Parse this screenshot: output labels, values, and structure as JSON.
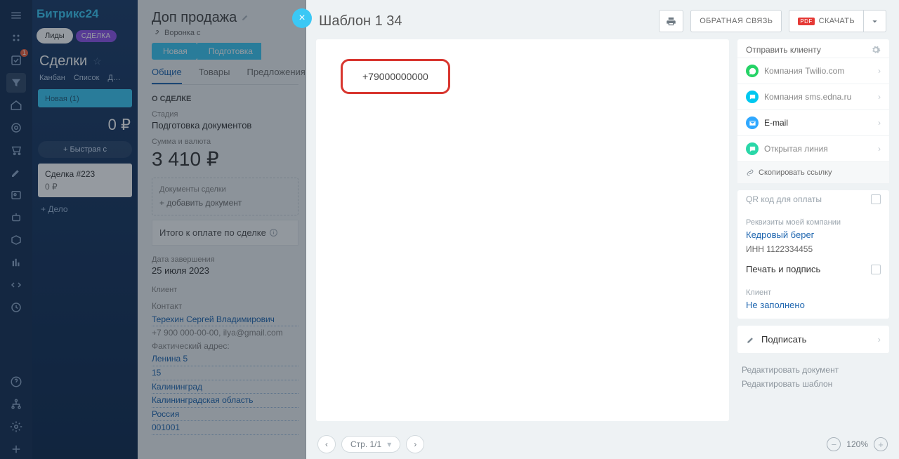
{
  "logo": {
    "a": "Битрикс",
    "b": "24"
  },
  "pills": {
    "leads": "Лиды",
    "dealBadge": "СДЕЛКА"
  },
  "side": {
    "title": "Сделки",
    "views": {
      "kanban": "Канбан",
      "list": "Список",
      "more": "Д…"
    },
    "stage": "Новая",
    "stageCount": "(1)",
    "sum": "0 ₽",
    "quick": "+  Быстрая с",
    "card": {
      "title": "Сделка #223",
      "price": "0 ₽"
    },
    "addTask": "+ Дело"
  },
  "deal": {
    "title": "Доп продажа",
    "crumb": "Воронка с",
    "stages": [
      "Новая",
      "Подготовка"
    ],
    "tabs": {
      "general": "Общие",
      "products": "Товары",
      "offers": "Предложения"
    },
    "aboutHead": "О СДЕЛКЕ",
    "stageLbl": "Стадия",
    "stageVal": "Подготовка документов",
    "sumLbl": "Сумма и валюта",
    "sumVal": "3 410 ₽",
    "docsHead": "Документы сделки",
    "addDoc": "+ добавить документ",
    "total": "Итого к оплате по сделке",
    "dateLbl": "Дата завершения",
    "dateVal": "25 июля 2023",
    "clientHead": "Клиент",
    "contactLbl": "Контакт",
    "contactName": "Терехин Сергей Владимирович",
    "contactLine": "+7 900 000-00-00, ilya@gmail.com",
    "addrLbl": "Фактический адрес:",
    "addr": [
      "Ленина 5",
      "15",
      "Калининград",
      "Калининградская область",
      "Россия",
      "001001"
    ]
  },
  "doc": {
    "title": "Шаблон 1 34",
    "feedback": "ОБРАТНАЯ СВЯЗЬ",
    "download": "СКАЧАТЬ",
    "phone": "+79000000000",
    "sendHead": "Отправить клиенту",
    "send": {
      "twilio": "Компания Twilio.com",
      "edna": "Компания sms.edna.ru",
      "email": "E-mail",
      "line": "Открытая линия"
    },
    "copy": "Скопировать ссылку",
    "qr": "QR код для оплаты",
    "reqHead": "Реквизиты моей компании",
    "company": "Кедровый берег",
    "inn": "ИНН 1122334455",
    "stamp": "Печать и подпись",
    "clientHead": "Клиент",
    "clientVal": "Не заполнено",
    "sign": "Подписать",
    "edit1": "Редактировать документ",
    "edit2": "Редактировать шаблон",
    "pager": "Стр. 1/1",
    "zoom": "120%"
  }
}
